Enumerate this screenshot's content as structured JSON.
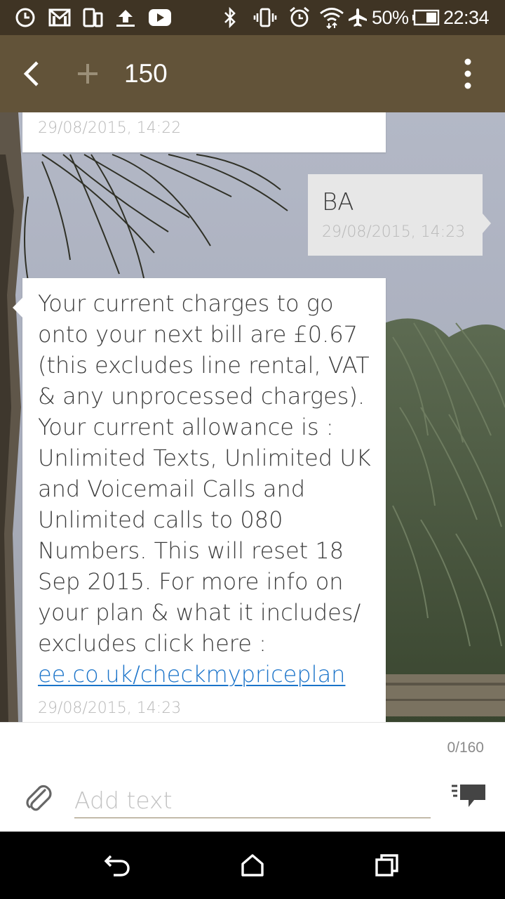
{
  "status_bar": {
    "battery_percent": "50%",
    "time": "22:34",
    "icons": [
      "clock-icon",
      "gmail-icon",
      "tablet-icon",
      "upload-icon",
      "youtube-icon",
      "bluetooth-icon",
      "vibrate-icon",
      "alarm-icon",
      "wifi-icon",
      "airplane-icon",
      "battery-icon"
    ]
  },
  "action_bar": {
    "title": "150",
    "icons": [
      "back-icon",
      "add-contact-icon",
      "overflow-menu-icon"
    ]
  },
  "messages": [
    {
      "direction": "incoming",
      "body": "",
      "timestamp": "29/08/2015, 14:22"
    },
    {
      "direction": "outgoing",
      "body": "BA",
      "timestamp": "29/08/2015, 14:23"
    },
    {
      "direction": "incoming",
      "body_lines": [
        "Your current charges to go",
        "onto your next bill are £0.67",
        "(this excludes line rental, VAT",
        "& any unprocessed charges).",
        "Your current allowance is :",
        "Unlimited Texts, Unlimited UK",
        "and Voicemail Calls and",
        "Unlimited calls to 080",
        "Numbers. This will reset 18",
        "Sep 2015. For more info on",
        "your plan & what it includes/",
        "excludes click here :"
      ],
      "link": "ee.co.uk/checkmypriceplan",
      "timestamp": "29/08/2015, 14:23"
    }
  ],
  "compose": {
    "char_counter": "0/160",
    "placeholder": "Add text",
    "value": "",
    "icons": [
      "attach-icon",
      "send-icon"
    ]
  },
  "nav_bar": {
    "icons": [
      "back-nav-icon",
      "home-icon",
      "recents-icon"
    ]
  },
  "colors": {
    "status_bar": "#3f3424",
    "action_bar": "#625339",
    "incoming_bubble": "#ffffff",
    "outgoing_bubble": "#e7e7e7",
    "link": "#1a73c9",
    "timestamp": "#b8b8b8"
  }
}
